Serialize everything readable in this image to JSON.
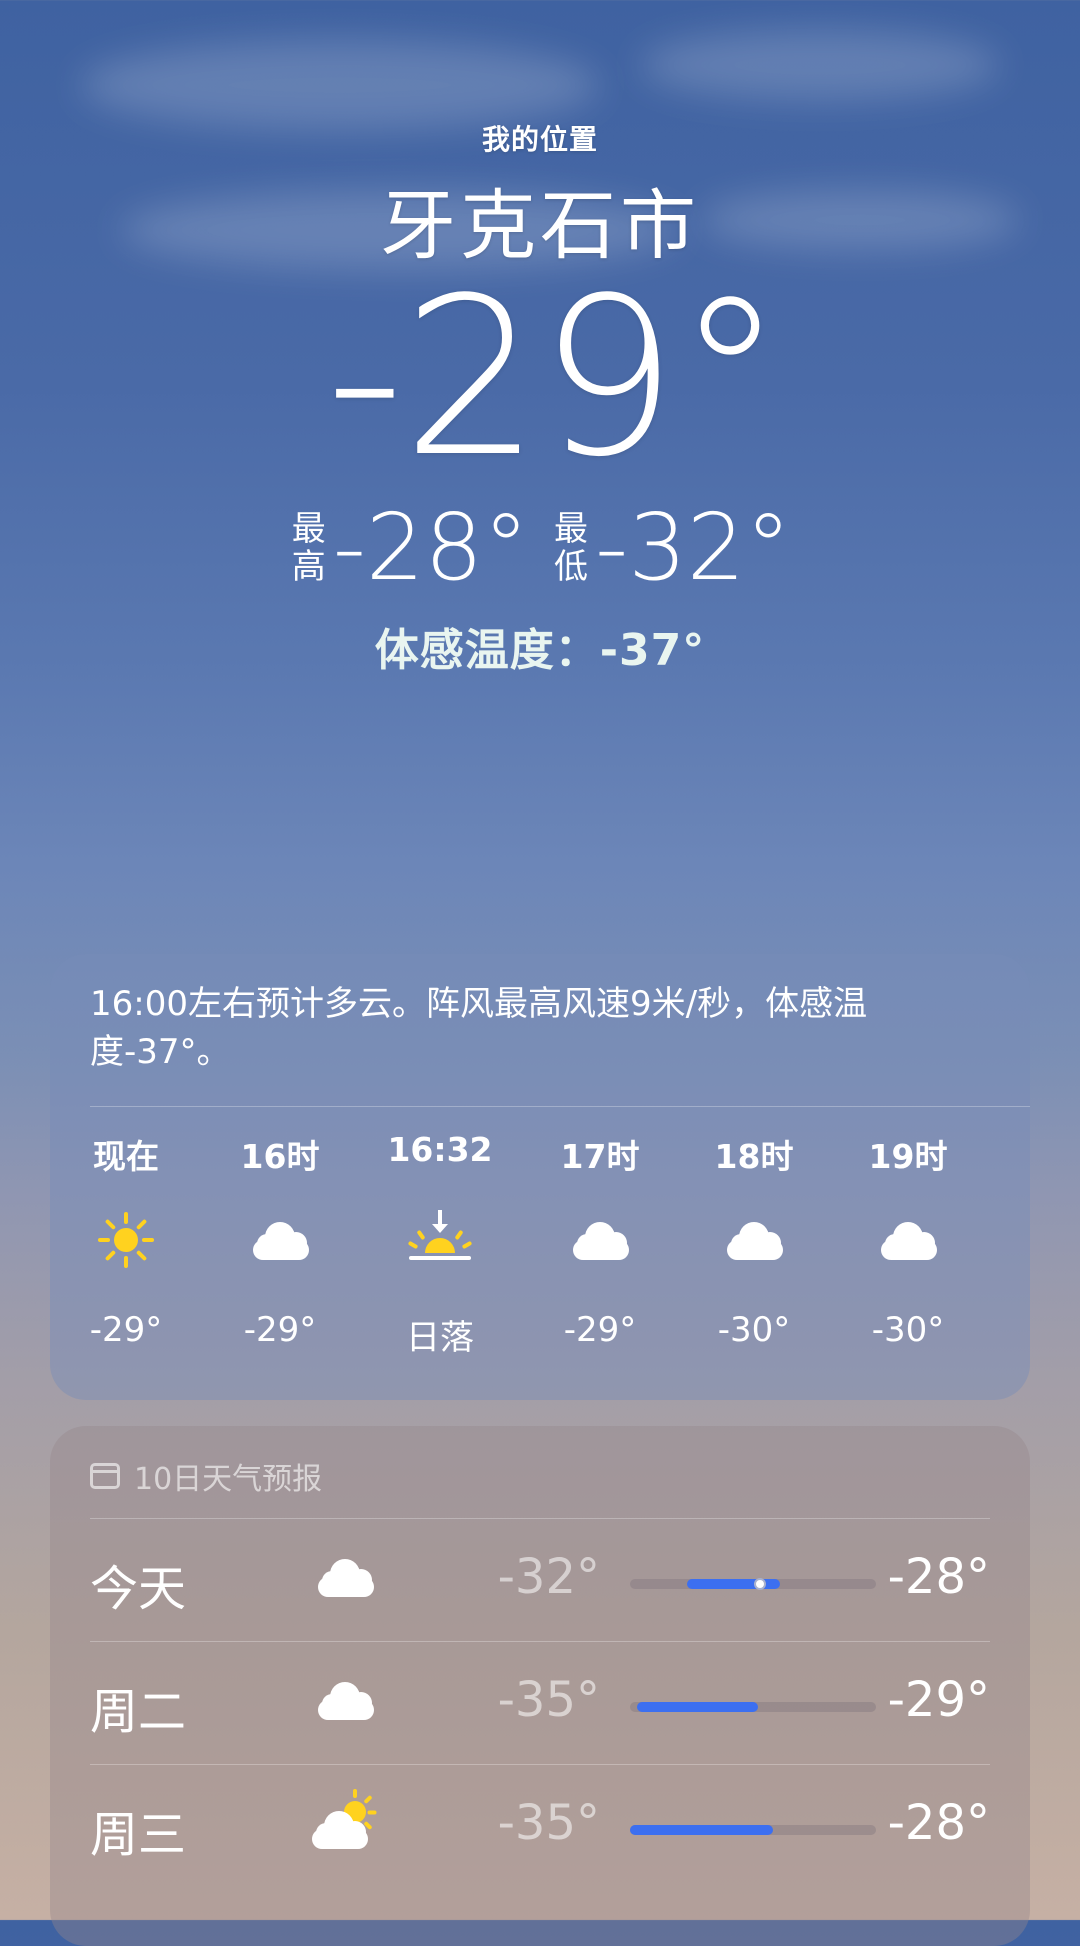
{
  "location": {
    "subtitle": "我的位置",
    "city": "牙克石市"
  },
  "current": {
    "temperature": "-29°",
    "high_label": "最\n高",
    "high_value": "-28°",
    "low_label": "最\n低",
    "low_value": "-32°",
    "feels_like": "体感温度：-37°"
  },
  "hourly": {
    "summary": "16:00左右预计多云。阵风最高风速9米/秒，体感温度-37°。",
    "items": [
      {
        "time": "现在",
        "icon": "sun-icon",
        "temp": "-29°"
      },
      {
        "time": "16时",
        "icon": "cloud-icon",
        "temp": "-29°"
      },
      {
        "time": "16:32",
        "icon": "sunset-icon",
        "temp": "日落"
      },
      {
        "time": "17时",
        "icon": "cloud-icon",
        "temp": "-29°"
      },
      {
        "time": "18时",
        "icon": "cloud-icon",
        "temp": "-30°"
      },
      {
        "time": "19时",
        "icon": "cloud-icon",
        "temp": "-30°"
      }
    ]
  },
  "ten_day": {
    "title": "10日天气预报",
    "days": [
      {
        "name": "今天",
        "icon": "cloud-icon",
        "low": "-32°",
        "high": "-28°",
        "bar_start": 0.23,
        "bar_end": 0.61,
        "current_marker": 0.53
      },
      {
        "name": "周二",
        "icon": "cloud-icon",
        "low": "-35°",
        "high": "-29°",
        "bar_start": 0.03,
        "bar_end": 0.52
      },
      {
        "name": "周三",
        "icon": "partly-cloudy-icon",
        "low": "-35°",
        "high": "-28°",
        "bar_start": 0.0,
        "bar_end": 0.58
      }
    ]
  },
  "colors": {
    "sun": "#ffd21f",
    "bar_fill": "#3c6ff0"
  }
}
